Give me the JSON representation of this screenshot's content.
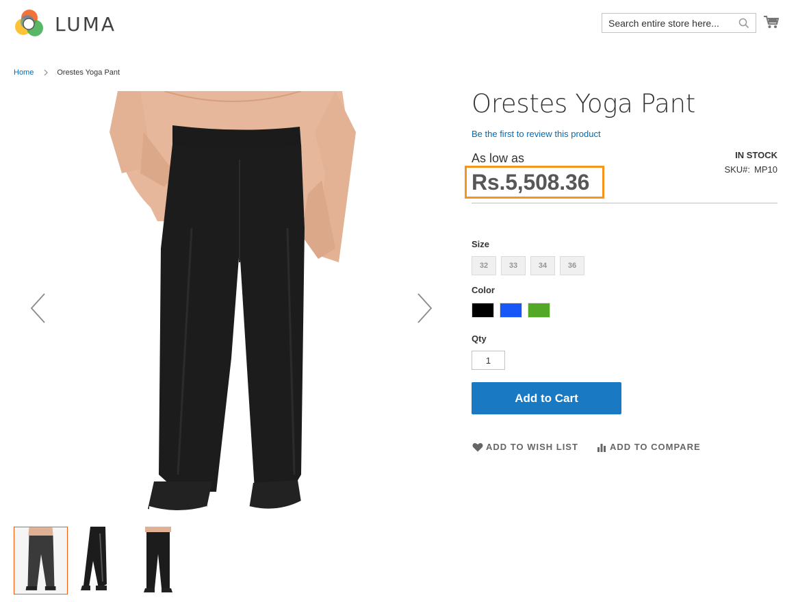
{
  "header": {
    "logo_text": "LUMA",
    "search_placeholder": "Search entire store here...",
    "icons": [
      "logo-icon",
      "search-icon",
      "cart-icon"
    ]
  },
  "breadcrumb": {
    "home": "Home",
    "current": "Orestes Yoga Pant"
  },
  "product": {
    "title": "Orestes Yoga Pant",
    "review_link": "Be the first to review this product",
    "price_prefix": "As low as",
    "price": "Rs.5,508.36",
    "stock": "IN STOCK",
    "sku_label": "SKU#:",
    "sku_value": "MP10",
    "size_label": "Size",
    "sizes": [
      "32",
      "33",
      "34",
      "36"
    ],
    "color_label": "Color",
    "colors": [
      {
        "name": "Black",
        "hex": "#000000"
      },
      {
        "name": "Blue",
        "hex": "#1857f7"
      },
      {
        "name": "Green",
        "hex": "#53a828"
      }
    ],
    "qty_label": "Qty",
    "qty_value": "1",
    "add_to_cart": "Add to Cart",
    "add_to_wishlist": "ADD TO WISH LIST",
    "add_to_compare": "ADD TO COMPARE"
  },
  "gallery": {
    "thumbnail_count": 3,
    "active_thumbnail": 1
  },
  "colors": {
    "accent": "#1979c3",
    "link": "#006bb4",
    "highlight_box": "#f7941e",
    "active_thumb_border": "#ff5501"
  }
}
